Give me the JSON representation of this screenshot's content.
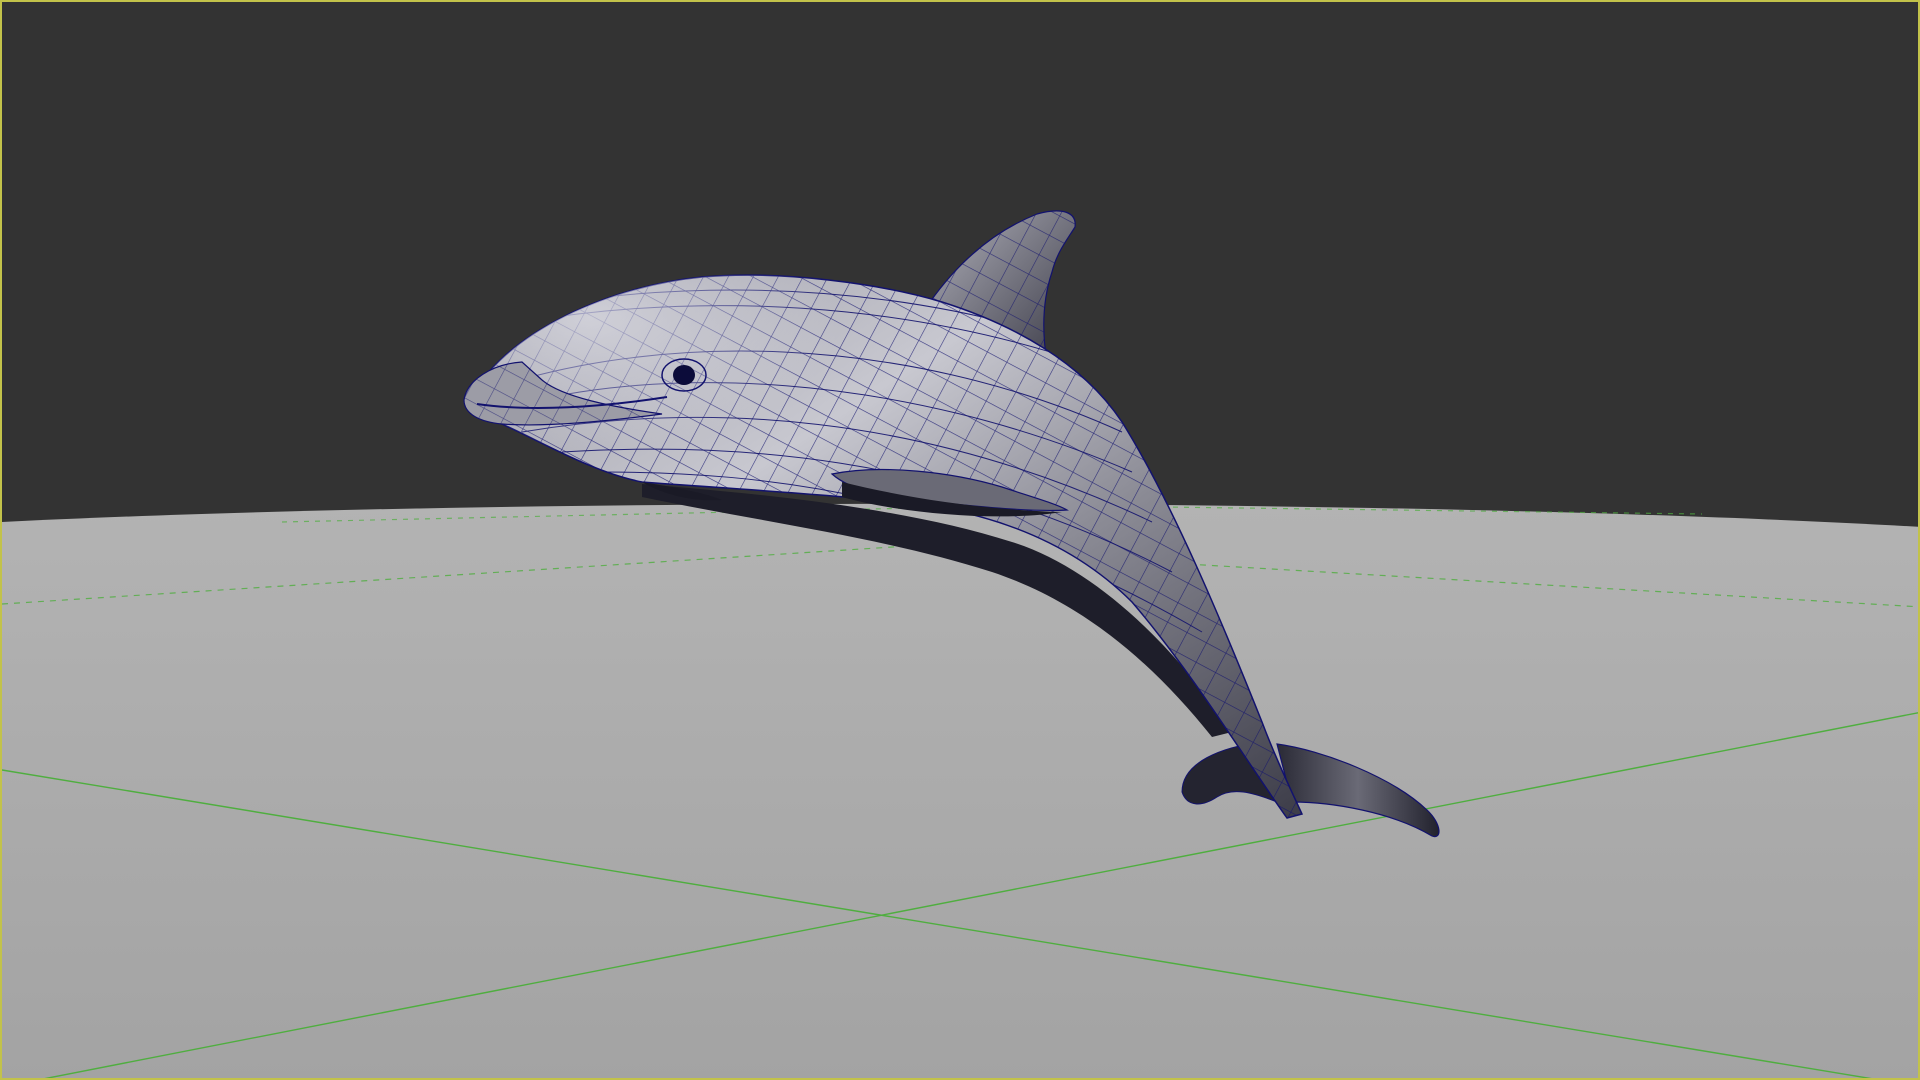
{
  "viewport": {
    "panel": "perspective-viewport",
    "active_border_color": "#c2c24a",
    "background_color": "#333333",
    "ground_color": "#a3a3a3",
    "grid_color": "#4fae3f",
    "wireframe_color": "#12126e",
    "shading": "smooth-shaded-with-wireframe-on-shaded"
  },
  "scene": {
    "model": "dolphin-mesh",
    "selection_highlight": "wireframe-overlay"
  }
}
